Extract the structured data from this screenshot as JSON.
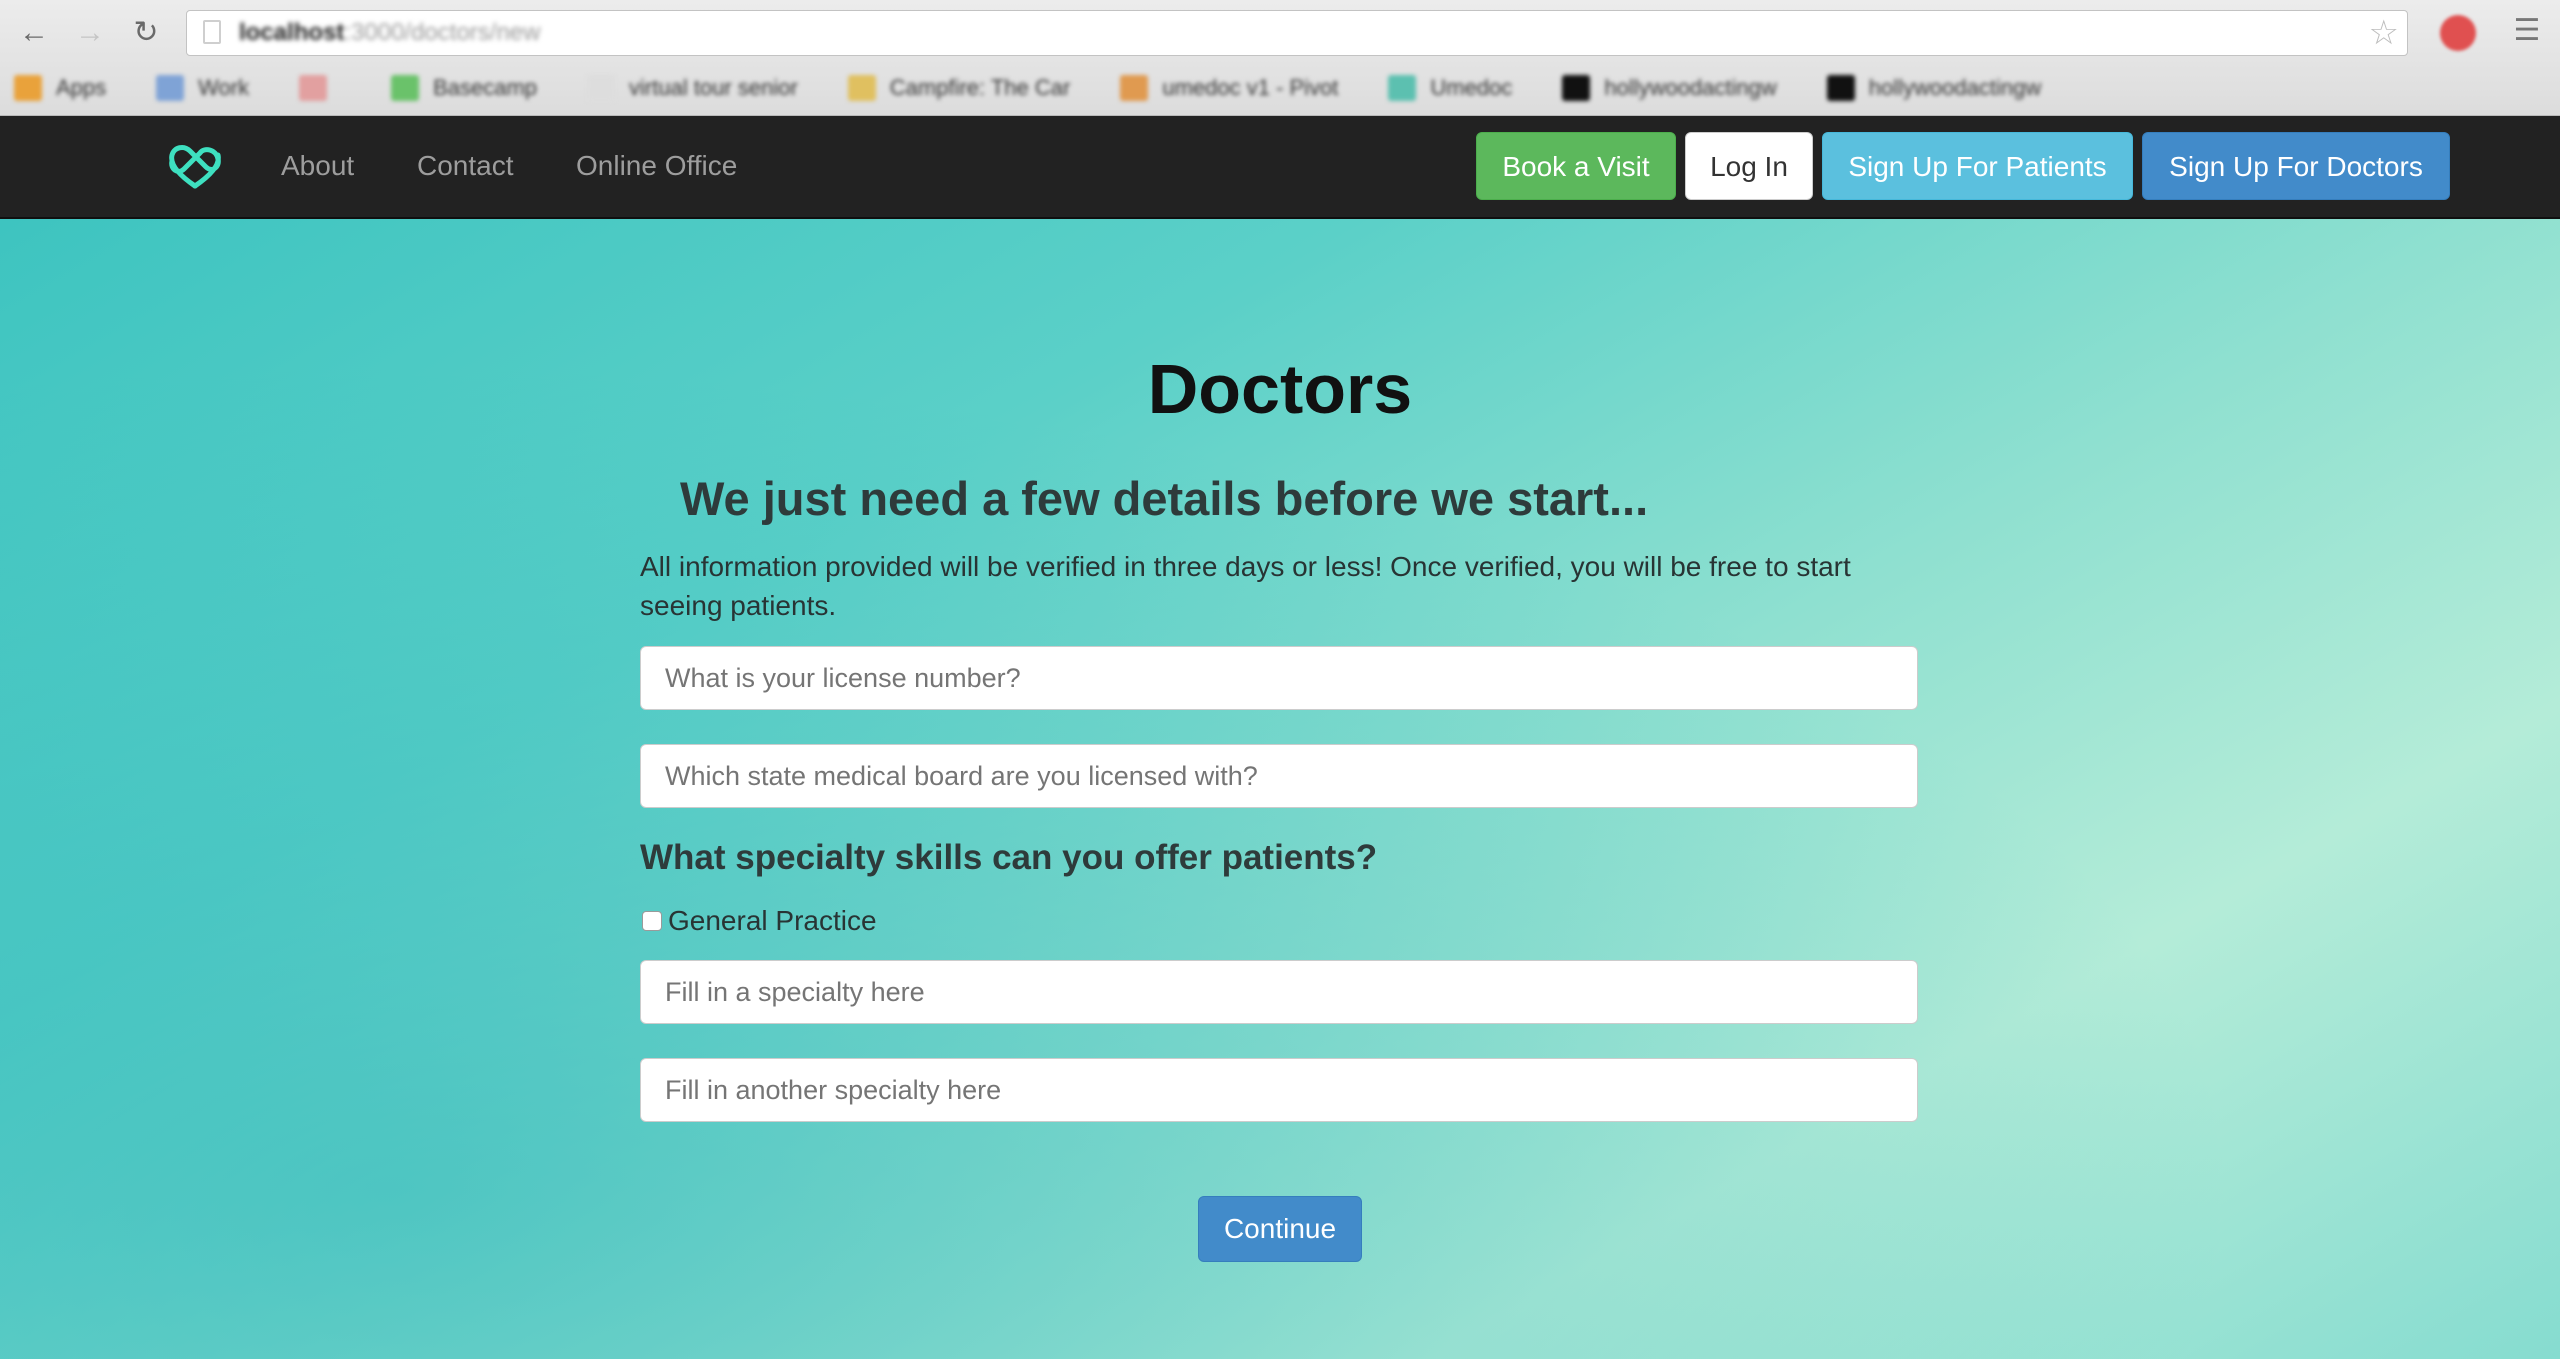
{
  "browser": {
    "url_host": "localhost",
    "url_path": ":3000/doctors/new",
    "bookmarks": [
      {
        "label": "Apps",
        "color": "#e9a23b"
      },
      {
        "label": "Work",
        "color": "#7fa3d6"
      },
      {
        "label": "",
        "color": "#e2a0a0"
      },
      {
        "label": "Basecamp",
        "color": "#6ac26a"
      },
      {
        "label": "virtual tour senior",
        "color": "#dddddd"
      },
      {
        "label": "Campfire: The Car",
        "color": "#e0c060"
      },
      {
        "label": "umedoc v1 - Pivot",
        "color": "#e09a50"
      },
      {
        "label": "Umedoc",
        "color": "#5cc0b0"
      },
      {
        "label": "hollywoodactingw",
        "color": "#111111"
      },
      {
        "label": "hollywoodactingw",
        "color": "#111111"
      }
    ]
  },
  "navbar": {
    "links": {
      "about": "About",
      "contact": "Contact",
      "online_office": "Online Office"
    },
    "buttons": {
      "book_visit": "Book a Visit",
      "log_in": "Log In",
      "signup_patients": "Sign Up For Patients",
      "signup_doctors": "Sign Up For Doctors"
    },
    "logo_color": "#3ee0c0"
  },
  "main": {
    "title": "Doctors",
    "subtitle": "We just need a few details before we start...",
    "intro": "All information provided will be verified in three days or less! Once verified, you will be free to start seeing patients.",
    "license_placeholder": "What is your license number?",
    "board_placeholder": "Which state medical board are you licensed with?",
    "specialty_heading": "What specialty skills can you offer patients?",
    "general_practice_label": "General Practice",
    "general_practice_checked": false,
    "specialty1_placeholder": "Fill in a specialty here",
    "specialty2_placeholder": "Fill in another specialty here",
    "continue_label": "Continue"
  }
}
